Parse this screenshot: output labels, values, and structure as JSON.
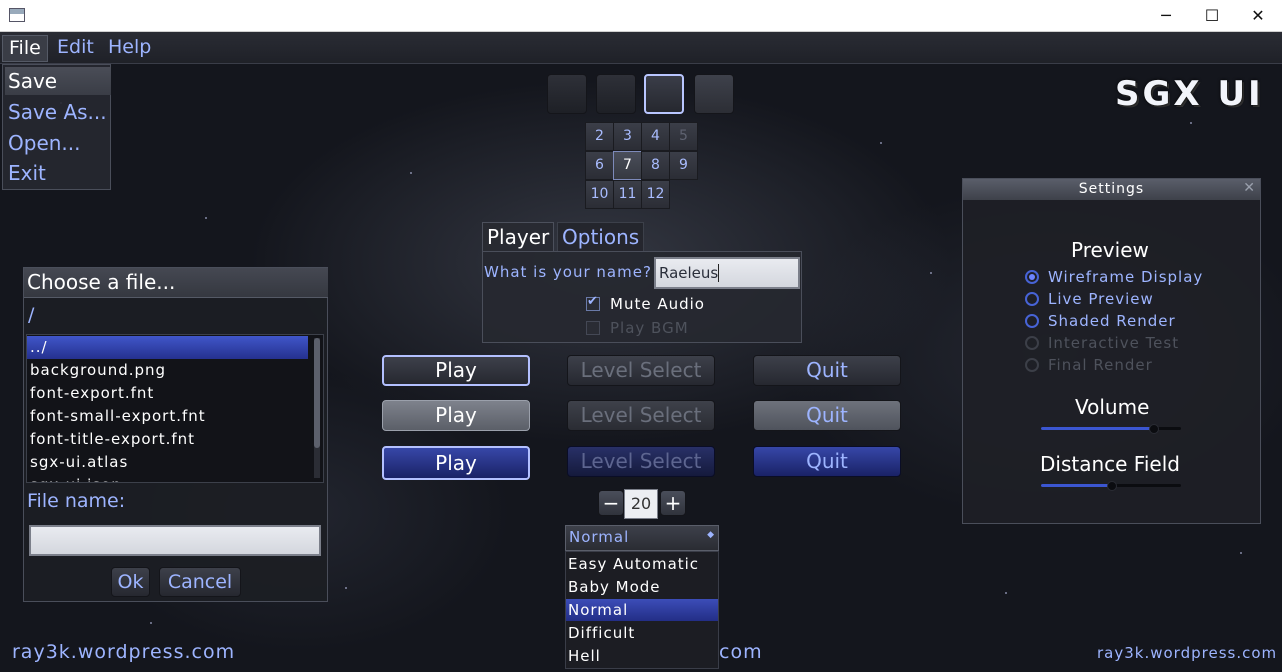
{
  "window": {
    "title": "",
    "controls": [
      "─",
      "☐",
      "✕"
    ]
  },
  "menubar": {
    "items": [
      "File",
      "Edit",
      "Help"
    ]
  },
  "file_menu": {
    "items": [
      "Save",
      "Save As...",
      "Open...",
      "Exit"
    ]
  },
  "logo": "SGX UI",
  "number_grid": {
    "row1": [
      "2",
      "3",
      "4",
      "5"
    ],
    "row2": [
      "6",
      "7",
      "8",
      "9"
    ],
    "row3": [
      "10",
      "11",
      "12"
    ]
  },
  "tabs": {
    "player": "Player",
    "options": "Options"
  },
  "player_panel": {
    "name_label": "What is your name?",
    "name_value": "Raeleus",
    "mute_label": "Mute Audio",
    "bgm_label": "Play BGM"
  },
  "buttons": {
    "play": "Play",
    "level_select": "Level Select",
    "quit": "Quit"
  },
  "spinner": {
    "minus": "−",
    "value": "20",
    "plus": "+"
  },
  "select": {
    "value": "Normal",
    "options": [
      "Easy Automatic",
      "Baby Mode",
      "Normal",
      "Difficult",
      "Hell"
    ]
  },
  "file_chooser": {
    "title": "Choose a file...",
    "path": "/",
    "files": [
      "../",
      "background.png",
      "font-export.fnt",
      "font-small-export.fnt",
      "font-title-export.fnt",
      "sgx-ui.atlas",
      "sgx-ui.json"
    ],
    "file_name_label": "File name:",
    "file_name_value": "",
    "ok": "Ok",
    "cancel": "Cancel"
  },
  "settings": {
    "title": "Settings",
    "close": "✕",
    "preview_header": "Preview",
    "preview_options": [
      "Wireframe Display",
      "Live Preview",
      "Shaded Render",
      "Interactive Test",
      "Final Render"
    ],
    "volume_header": "Volume",
    "volume_level": 0.8,
    "distance_header": "Distance Field",
    "distance_level": 0.5
  },
  "footer": {
    "left": "ray3k.wordpress.com",
    "center": "com",
    "right": "ray3k.wordpress.com"
  },
  "colors": {
    "accent": "#9db4ff",
    "selection": "#3c4db8"
  }
}
